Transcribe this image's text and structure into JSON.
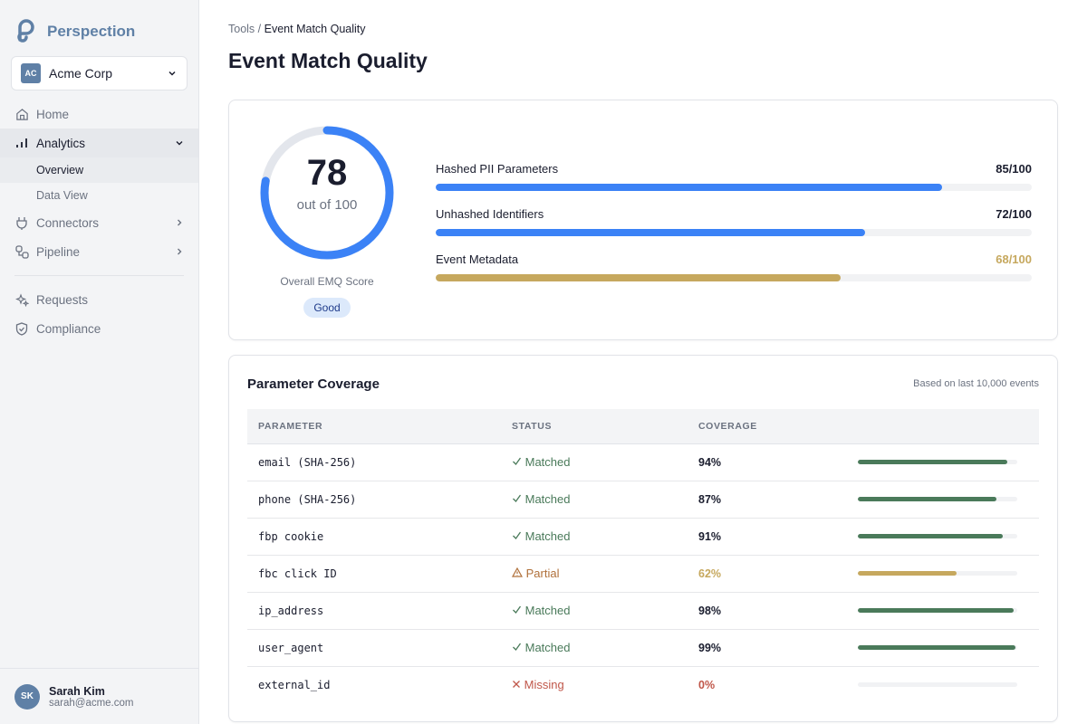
{
  "app": {
    "name": "Perspection"
  },
  "org": {
    "initials": "AC",
    "name": "Acme Corp"
  },
  "nav": {
    "home": "Home",
    "analytics": "Analytics",
    "overview": "Overview",
    "data_view": "Data View",
    "connectors": "Connectors",
    "pipeline": "Pipeline",
    "requests": "Requests",
    "compliance": "Compliance"
  },
  "user": {
    "initials": "SK",
    "name": "Sarah Kim",
    "email": "sarah@acme.com"
  },
  "breadcrumb": {
    "parent": "Tools",
    "sep": "/",
    "current": "Event Match Quality"
  },
  "page_title": "Event Match Quality",
  "score": {
    "value": "78",
    "value_num": 78,
    "max": "out of 100",
    "label": "Overall EMQ Score",
    "badge": "Good",
    "color": "#3b82f6"
  },
  "metrics": [
    {
      "label": "Hashed PII Parameters",
      "value": "85/100",
      "pct": 85,
      "color": "#3b82f6",
      "text_color": "#1a1d2e"
    },
    {
      "label": "Unhashed Identifiers",
      "value": "72/100",
      "pct": 72,
      "color": "#3b82f6",
      "text_color": "#1a1d2e"
    },
    {
      "label": "Event Metadata",
      "value": "68/100",
      "pct": 68,
      "color": "#c6a85e",
      "text_color": "#c6a85e"
    }
  ],
  "coverage": {
    "title": "Parameter Coverage",
    "note": "Based on last 10,000 events",
    "headers": [
      "PARAMETER",
      "STATUS",
      "COVERAGE"
    ],
    "rows": [
      {
        "param": "email (SHA-256)",
        "icon": "check",
        "status": "Matched",
        "coverage": "94%",
        "pct": 94,
        "status_color": "#4a7a5a",
        "cov_color": "#1a1d2e",
        "bar_color": "#4a7a5a"
      },
      {
        "param": "phone (SHA-256)",
        "icon": "check",
        "status": "Matched",
        "coverage": "87%",
        "pct": 87,
        "status_color": "#4a7a5a",
        "cov_color": "#1a1d2e",
        "bar_color": "#4a7a5a"
      },
      {
        "param": "fbp cookie",
        "icon": "check",
        "status": "Matched",
        "coverage": "91%",
        "pct": 91,
        "status_color": "#4a7a5a",
        "cov_color": "#1a1d2e",
        "bar_color": "#4a7a5a"
      },
      {
        "param": "fbc click ID",
        "icon": "warning",
        "status": "Partial",
        "coverage": "62%",
        "pct": 62,
        "status_color": "#b0703a",
        "cov_color": "#c6a85e",
        "bar_color": "#c6a85e"
      },
      {
        "param": "ip_address",
        "icon": "check",
        "status": "Matched",
        "coverage": "98%",
        "pct": 98,
        "status_color": "#4a7a5a",
        "cov_color": "#1a1d2e",
        "bar_color": "#4a7a5a"
      },
      {
        "param": "user_agent",
        "icon": "check",
        "status": "Matched",
        "coverage": "99%",
        "pct": 99,
        "status_color": "#4a7a5a",
        "cov_color": "#1a1d2e",
        "bar_color": "#4a7a5a"
      },
      {
        "param": "external_id",
        "icon": "x",
        "status": "Missing",
        "coverage": "0%",
        "pct": 0,
        "status_color": "#c0574a",
        "cov_color": "#c0574a",
        "bar_color": "#c0574a"
      }
    ]
  }
}
